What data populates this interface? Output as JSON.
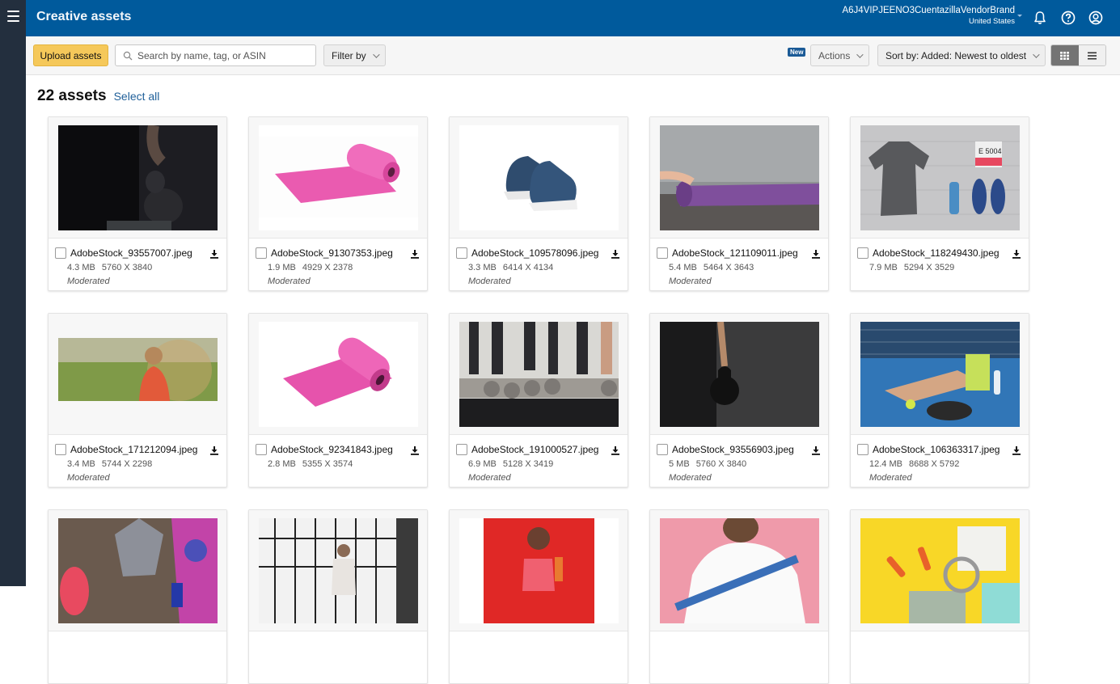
{
  "header": {
    "title": "Creative assets",
    "account_name": "A6J4VIPJEENO3CuentazillaVendorBrand",
    "account_country": "United States",
    "icons": [
      "menu-icon",
      "bell-icon",
      "help-icon",
      "user-icon"
    ]
  },
  "toolbar": {
    "upload_label": "Upload assets",
    "search_placeholder": "Search by name, tag, or ASIN",
    "search_value": "",
    "filter_label": "Filter by",
    "new_badge": "New",
    "actions_label": "Actions",
    "sort_label": "Sort by: Added: Newest to oldest",
    "view_modes": [
      "grid",
      "list"
    ],
    "active_view": "grid"
  },
  "summary": {
    "count_label": "22 assets",
    "select_all_label": "Select all"
  },
  "colors": {
    "header_bg": "#005a9c",
    "rail_bg": "#232f3e",
    "upload_button": "#f5c85a",
    "link": "#1f5f99"
  },
  "assets": [
    {
      "name": "AdobeStock_93557007.jpeg",
      "size": "4.3 MB",
      "dimensions": "5760 X 3840",
      "status": "Moderated",
      "thumb": "kettlebell-dark"
    },
    {
      "name": "AdobeStock_91307353.jpeg",
      "size": "1.9 MB",
      "dimensions": "4929 X 2378",
      "status": "Moderated",
      "thumb": "pink-yoga-mat"
    },
    {
      "name": "AdobeStock_109578096.jpeg",
      "size": "3.3 MB",
      "dimensions": "6414 X 4134",
      "status": "Moderated",
      "thumb": "blue-sneakers"
    },
    {
      "name": "AdobeStock_121109011.jpeg",
      "size": "5.4 MB",
      "dimensions": "5464 X 3643",
      "status": "Moderated",
      "thumb": "purple-yoga-mat"
    },
    {
      "name": "AdobeStock_118249430.jpeg",
      "size": "7.9 MB",
      "dimensions": "5294 X 3529",
      "status": "",
      "thumb": "running-flatlay"
    },
    {
      "name": "AdobeStock_171212094.jpeg",
      "size": "3.4 MB",
      "dimensions": "5744 X 2298",
      "status": "Moderated",
      "thumb": "woman-landscape"
    },
    {
      "name": "AdobeStock_92341843.jpeg",
      "size": "2.8 MB",
      "dimensions": "5355 X 3574",
      "status": "",
      "thumb": "pink-yoga-mat-2"
    },
    {
      "name": "AdobeStock_191000527.jpeg",
      "size": "6.9 MB",
      "dimensions": "5128 X 3419",
      "status": "Moderated",
      "thumb": "yoga-mats-legs"
    },
    {
      "name": "AdobeStock_93556903.jpeg",
      "size": "5 MB",
      "dimensions": "5760 X 3840",
      "status": "Moderated",
      "thumb": "kettlebell-grey"
    },
    {
      "name": "AdobeStock_106363317.jpeg",
      "size": "12.4 MB",
      "dimensions": "8688 X 5792",
      "status": "Moderated",
      "thumb": "tennis-player"
    },
    {
      "name": "",
      "size": "",
      "dimensions": "",
      "status": "",
      "thumb": "sports-bra-flatlay"
    },
    {
      "name": "",
      "size": "",
      "dimensions": "",
      "status": "",
      "thumb": "woman-window"
    },
    {
      "name": "",
      "size": "",
      "dimensions": "",
      "status": "",
      "thumb": "woman-red-bg"
    },
    {
      "name": "",
      "size": "",
      "dimensions": "",
      "status": "",
      "thumb": "man-boxing-wraps"
    },
    {
      "name": "",
      "size": "",
      "dimensions": "",
      "status": "",
      "thumb": "yellow-flatlay"
    }
  ]
}
